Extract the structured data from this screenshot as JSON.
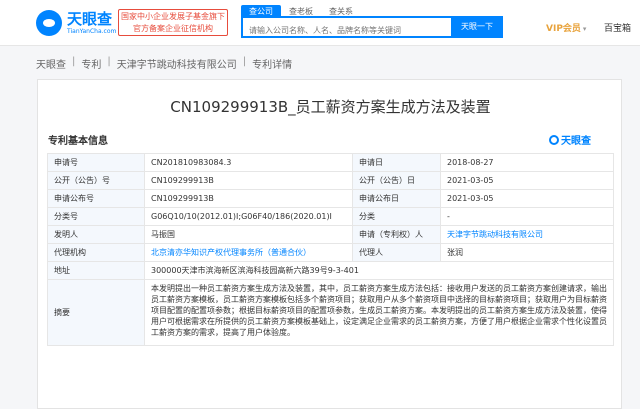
{
  "header": {
    "logo_cn": "天眼查",
    "logo_en": "TianYanCha.com",
    "banner_line1": "国家中小企业发展子基金旗下",
    "banner_line2": "官方备案企业征信机构",
    "search_tabs": [
      "查公司",
      "查老板",
      "查关系"
    ],
    "search_placeholder": "请输入公司名称、人名、品牌名称等关键词",
    "search_button": "天眼一下",
    "vip_label": "VIP会员",
    "user_label": "百宝箱"
  },
  "breadcrumb": [
    "天眼查",
    "专利",
    "天津字节跳动科技有限公司",
    "专利详情"
  ],
  "patent": {
    "title": "CN109299913B_员工薪资方案生成方法及装置",
    "section_title": "专利基本信息",
    "brand": "天眼查"
  },
  "rows": [
    {
      "l1": "申请号",
      "v1": "CN201810983084.3",
      "l2": "申请日",
      "v2": "2018-08-27"
    },
    {
      "l1": "公开（公告）号",
      "v1": "CN109299913B",
      "l2": "公开（公告）日",
      "v2": "2021-03-05"
    },
    {
      "l1": "申请公布号",
      "v1": "CN109299913B",
      "l2": "申请公布日",
      "v2": "2021-03-05"
    },
    {
      "l1": "分类号",
      "v1": "G06Q10/10(2012.01)I;G06F40/186(2020.01)I",
      "l2": "分类",
      "v2": "-"
    },
    {
      "l1": "发明人",
      "v1": "马振国",
      "l2": "申请（专利权）人",
      "v2": "天津字节跳动科技有限公司"
    },
    {
      "l1": "代理机构",
      "v1": "北京清亦华知识产权代理事务所（普通合伙）",
      "l2": "代理人",
      "v2": "张润"
    }
  ],
  "address": {
    "label": "地址",
    "value": "300000天津市滨海新区滨海科技园高新六路39号9-3-401"
  },
  "abstract": {
    "label": "摘要",
    "value": "本发明提出一种员工薪资方案生成方法及装置，其中，员工薪资方案生成方法包括：接收用户发送的员工薪资方案创建请求，输出员工薪资方案模板，员工薪资方案模板包括多个薪资项目；获取用户从多个薪资项目中选择的目标薪资项目；获取用户为目标薪资项目配置的配置项参数；根据目标薪资项目的配置项参数，生成员工薪资方案。本发明提出的员工薪资方案生成方法及装置，使得用户可根据需求在所提供的员工薪资方案模板基础上，设定满足企业需求的员工薪资方案，方便了用户根据企业需求个性化设置员工薪资方案的需求，提高了用户体验度。"
  },
  "colors": {
    "accent": "#0084ff",
    "label_bg": "#f4f8fd",
    "vip": "#e8a33d",
    "banner": "#e74c3c"
  }
}
